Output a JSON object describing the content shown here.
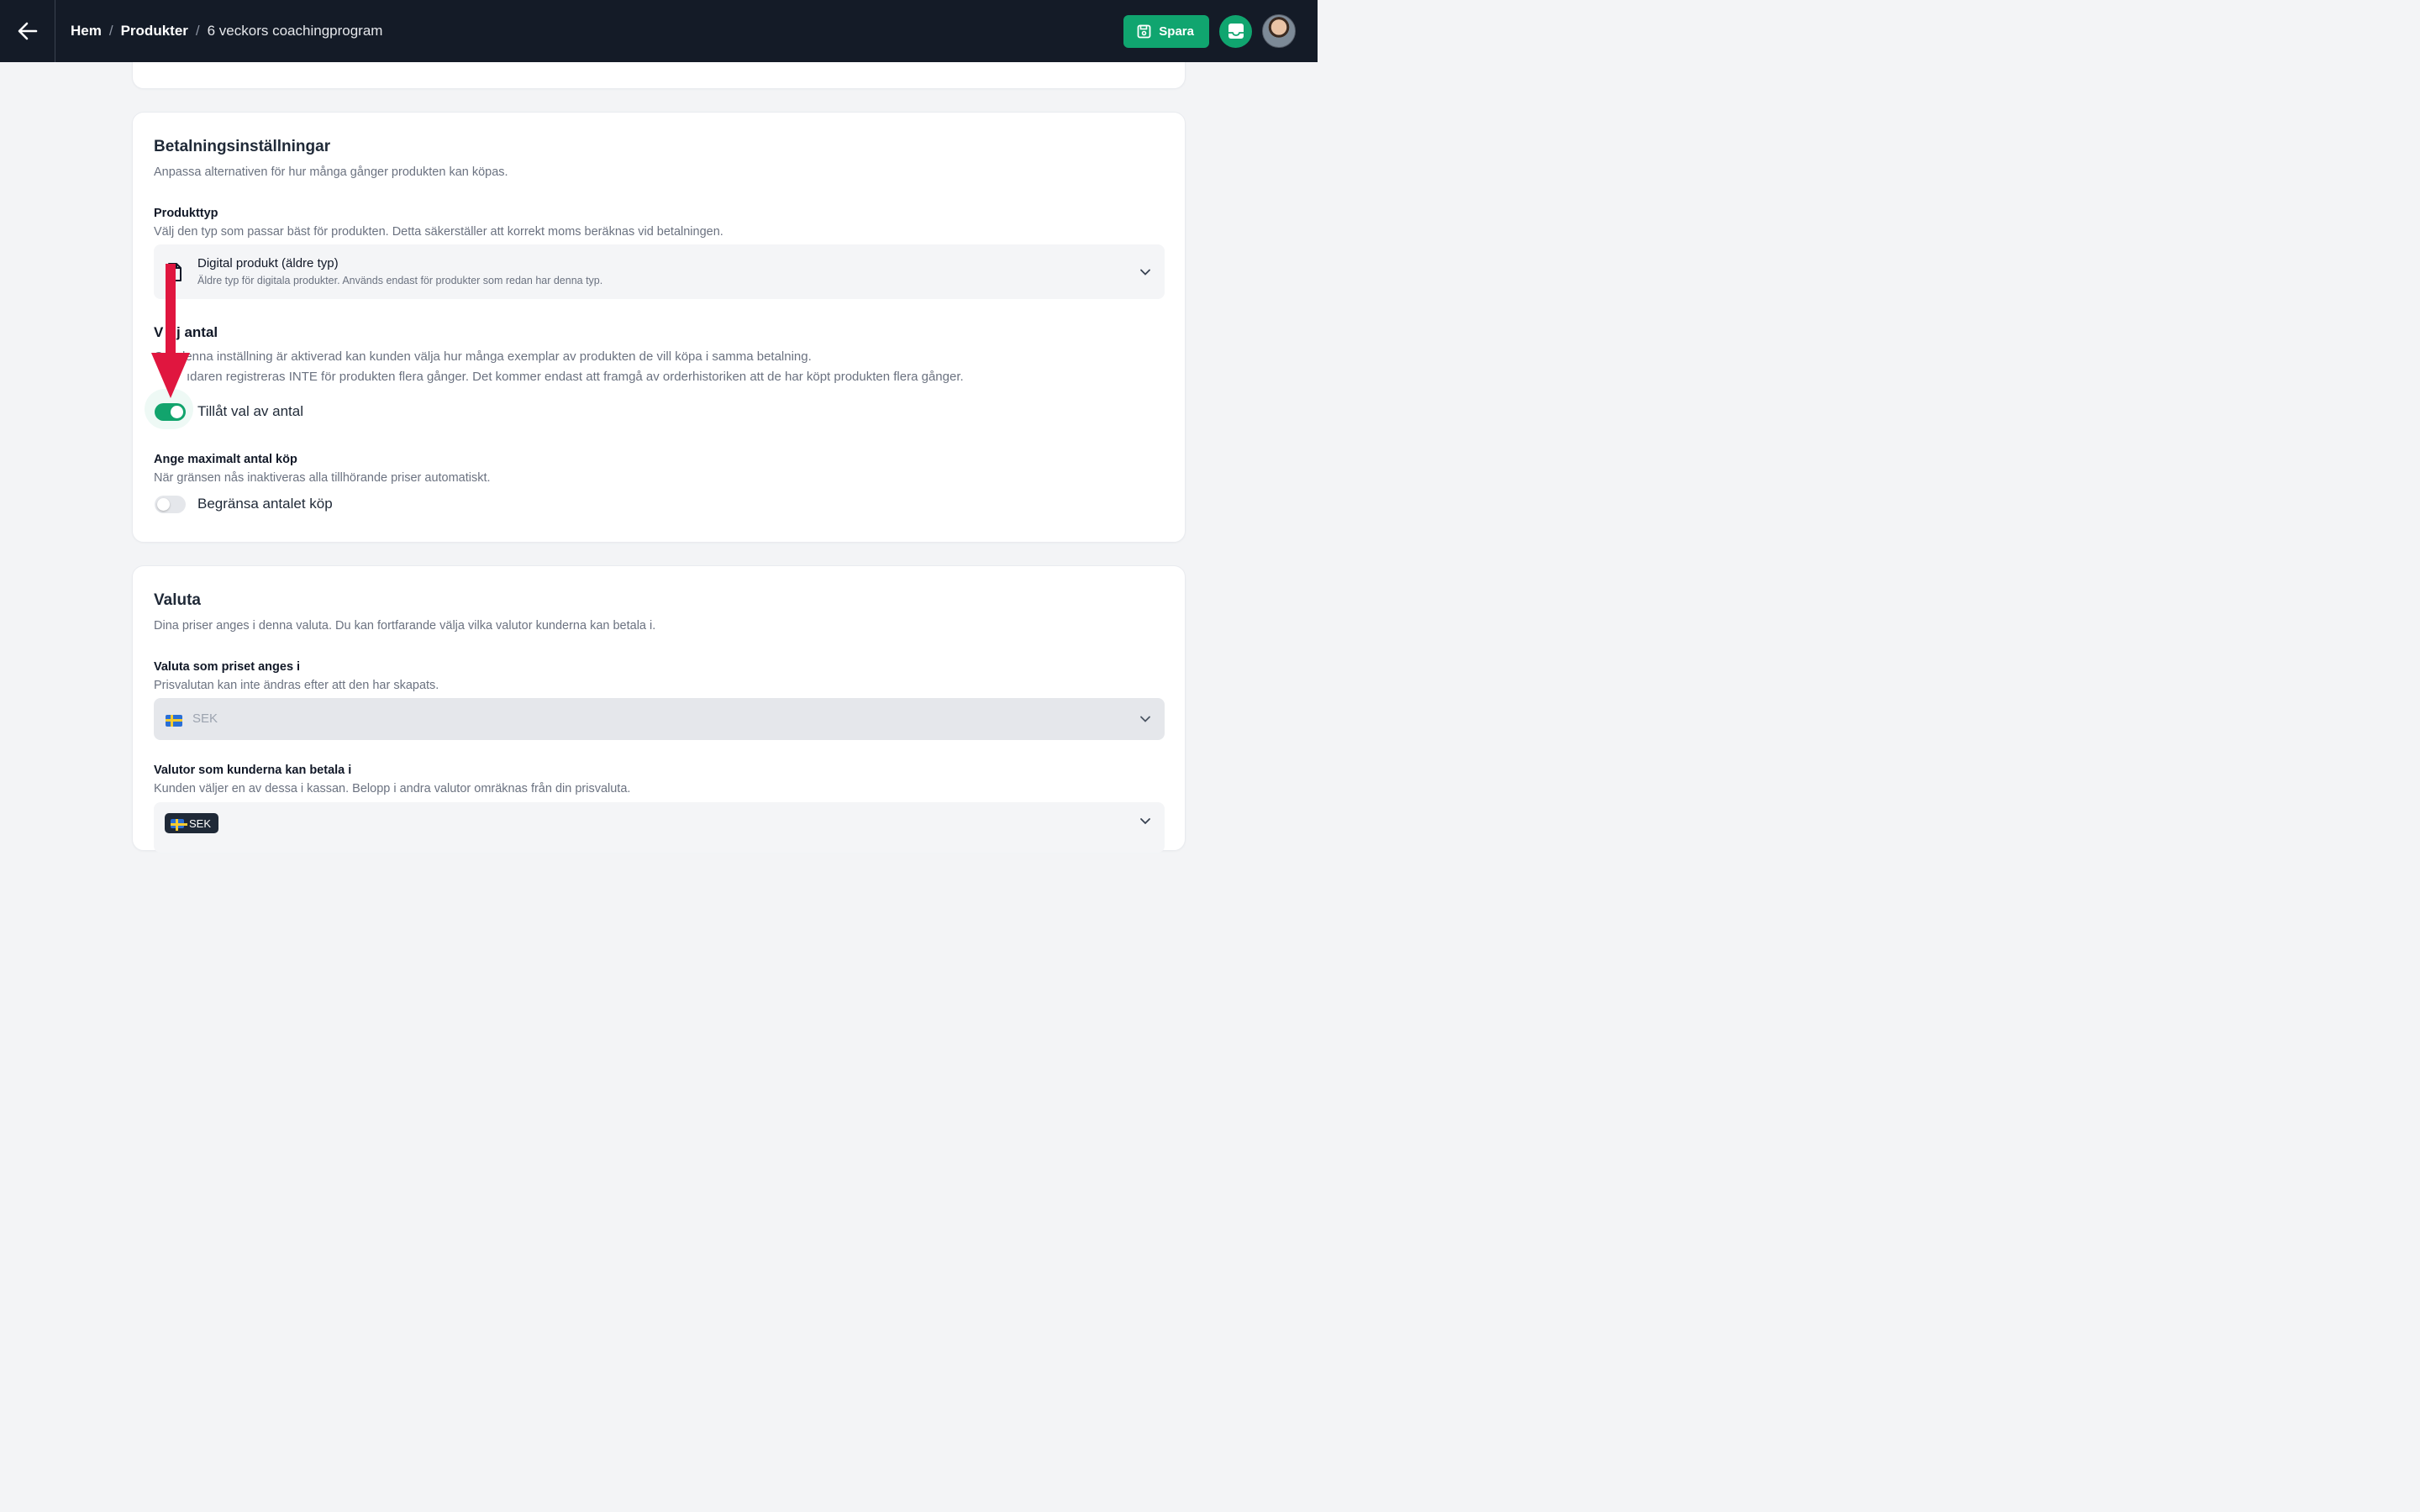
{
  "header": {
    "breadcrumb": [
      {
        "label": "Hem"
      },
      {
        "label": "Produkter"
      },
      {
        "label": "6 veckors coachingprogram"
      }
    ],
    "save_label": "Spara"
  },
  "payment": {
    "title": "Betalningsinställningar",
    "subtitle": "Anpassa alternativen för hur många gånger produkten kan köpas.",
    "product_type": {
      "label": "Produkttyp",
      "help": "Välj den typ som passar bäst för produkten. Detta säkerställer att korrekt moms beräknas vid betalningen.",
      "selected_title": "Digital produkt (äldre typ)",
      "selected_description": "Äldre typ för digitala produkter. Används endast för produkter som redan har denna typ."
    },
    "quantity": {
      "label_visible_1": "V",
      "label_visible_2": "j antal",
      "help_line1_visible_1": "O",
      "help_line1_visible_2": "denna inställning är aktiverad kan kunden välja hur många exemplar av produkten de vill köpa i samma betalning.",
      "help_line2_visible": "ıdaren registreras INTE för produkten flera gånger. Det kommer endast att framgå av orderhistoriken att de har köpt produkten flera gånger.",
      "toggle_label": "Tillåt val av antal",
      "toggle_on": true
    },
    "max_purchases": {
      "label": "Ange maximalt antal köp",
      "help": "När gränsen nås inaktiveras alla tillhörande priser automatiskt.",
      "toggle_label": "Begränsa antalet köp",
      "toggle_on": false
    }
  },
  "currency": {
    "title": "Valuta",
    "subtitle": "Dina priser anges i denna valuta. Du kan fortfarande välja vilka valutor kunderna kan betala i.",
    "price_currency": {
      "label": "Valuta som priset anges i",
      "help": "Prisvalutan kan inte ändras efter att den har skapats.",
      "value": "SEK"
    },
    "payable_currencies": {
      "label": "Valutor som kunderna kan betala i",
      "help": "Kunden väljer en av dessa i kassan. Belopp i andra valutor omräknas från din prisvaluta.",
      "chips": [
        "SEK"
      ]
    }
  },
  "icons": {
    "back": "arrow-left-icon",
    "save": "floppy-disk-icon",
    "inbox": "inbox-icon",
    "file": "file-icon",
    "chevron": "chevron-down-icon",
    "flag": "sweden-flag-icon",
    "annotation": "red-arrow-annotation"
  },
  "colors": {
    "topbar": "#141b27",
    "accent_green": "#10a56f",
    "annotation_red": "#e0163f"
  }
}
